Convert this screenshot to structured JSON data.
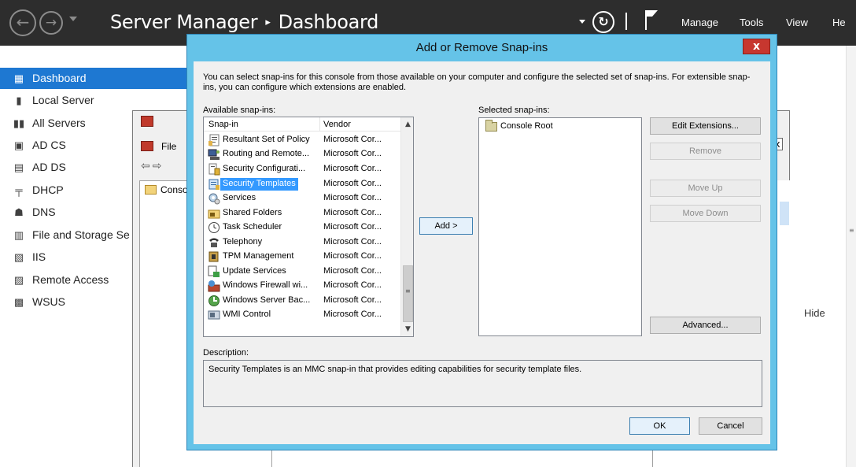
{
  "header": {
    "title_app": "Server Manager",
    "title_page": "Dashboard",
    "separator": "▸",
    "menu": {
      "manage": "Manage",
      "tools": "Tools",
      "view": "View",
      "help": "He"
    }
  },
  "sidebar": {
    "items": [
      {
        "label": "Dashboard",
        "icon": "dashboard-icon",
        "glyph": "▦",
        "active": true
      },
      {
        "label": "Local Server",
        "icon": "server-icon",
        "glyph": "▮"
      },
      {
        "label": "All Servers",
        "icon": "servers-icon",
        "glyph": "▮▮"
      },
      {
        "label": "AD CS",
        "icon": "adcs-icon",
        "glyph": "▣"
      },
      {
        "label": "AD DS",
        "icon": "adds-icon",
        "glyph": "▤"
      },
      {
        "label": "DHCP",
        "icon": "dhcp-icon",
        "glyph": "╤"
      },
      {
        "label": "DNS",
        "icon": "dns-icon",
        "glyph": "☗"
      },
      {
        "label": "File and Storage Se",
        "icon": "file-storage-icon",
        "glyph": "▥"
      },
      {
        "label": "IIS",
        "icon": "iis-icon",
        "glyph": "▧"
      },
      {
        "label": "Remote Access",
        "icon": "remote-access-icon",
        "glyph": "▨"
      },
      {
        "label": "WSUS",
        "icon": "wsus-icon",
        "glyph": "▩"
      }
    ]
  },
  "right_panel": {
    "hide": "Hide"
  },
  "mmc": {
    "file_menu": "File",
    "tree_item": "Conso"
  },
  "dialog": {
    "title": "Add or Remove Snap-ins",
    "close": "x",
    "intro": "You can select snap-ins for this console from those available on your computer and configure the selected set of snap-ins. For extensible snap-ins, you can configure which extensions are enabled.",
    "available_label": "Available snap-ins:",
    "selected_label": "Selected snap-ins:",
    "columns": {
      "snapin": "Snap-in",
      "vendor": "Vendor"
    },
    "snapins": [
      {
        "name": "Resultant Set of Policy",
        "vendor": "Microsoft Cor...",
        "icon": "rsop-icon"
      },
      {
        "name": "Routing and Remote...",
        "vendor": "Microsoft Cor...",
        "icon": "routing-icon"
      },
      {
        "name": "Security Configurati...",
        "vendor": "Microsoft Cor...",
        "icon": "security-config-icon"
      },
      {
        "name": "Security Templates",
        "vendor": "Microsoft Cor...",
        "icon": "security-templates-icon",
        "selected": true
      },
      {
        "name": "Services",
        "vendor": "Microsoft Cor...",
        "icon": "services-icon"
      },
      {
        "name": "Shared Folders",
        "vendor": "Microsoft Cor...",
        "icon": "shared-folders-icon"
      },
      {
        "name": "Task Scheduler",
        "vendor": "Microsoft Cor...",
        "icon": "task-scheduler-icon"
      },
      {
        "name": "Telephony",
        "vendor": "Microsoft Cor...",
        "icon": "telephony-icon"
      },
      {
        "name": "TPM Management",
        "vendor": "Microsoft Cor...",
        "icon": "tpm-icon"
      },
      {
        "name": "Update Services",
        "vendor": "Microsoft Cor...",
        "icon": "update-services-icon"
      },
      {
        "name": "Windows Firewall wi...",
        "vendor": "Microsoft Cor...",
        "icon": "firewall-icon"
      },
      {
        "name": "Windows Server Bac...",
        "vendor": "Microsoft Cor...",
        "icon": "server-backup-icon"
      },
      {
        "name": "WMI Control",
        "vendor": "Microsoft Cor...",
        "icon": "wmi-icon"
      }
    ],
    "selected_snapins": [
      {
        "name": "Console Root",
        "icon": "folder-icon"
      }
    ],
    "buttons": {
      "add": "Add >",
      "edit_extensions": "Edit Extensions...",
      "remove": "Remove",
      "move_up": "Move Up",
      "move_down": "Move Down",
      "advanced": "Advanced...",
      "ok": "OK",
      "cancel": "Cancel"
    },
    "description_label": "Description:",
    "description": "Security Templates is an MMC snap-in that provides editing capabilities for security template files."
  }
}
